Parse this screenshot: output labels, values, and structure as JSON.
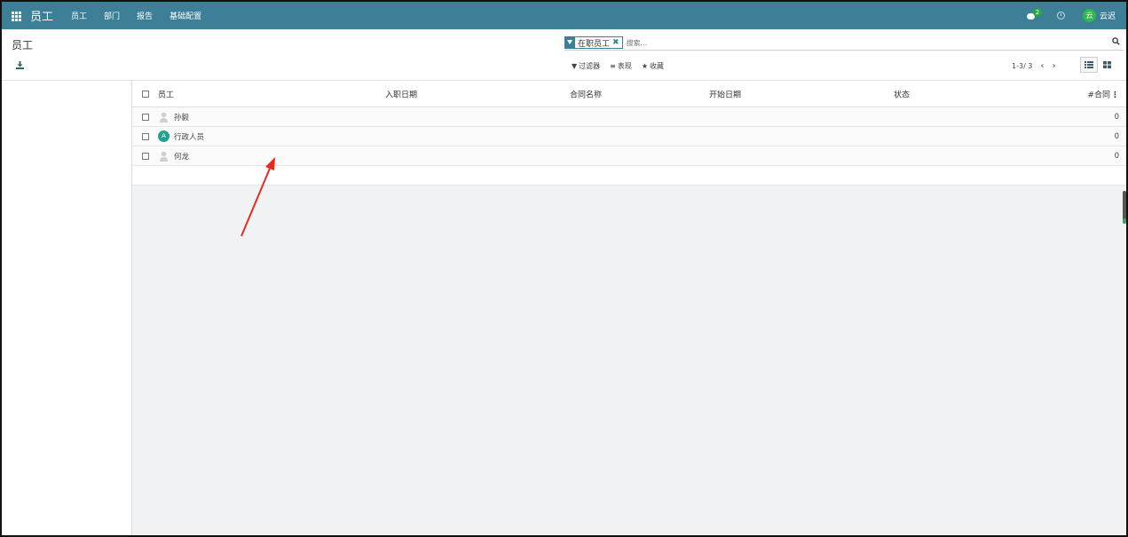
{
  "navbar": {
    "brand": "员工",
    "menu": [
      "员工",
      "部门",
      "报告",
      "基础配置"
    ],
    "chat_badge": "2",
    "user_avatar": "云",
    "user_name": "云迟"
  },
  "control_panel": {
    "title": "员工",
    "facet_label": "在职员工",
    "search_placeholder": "搜索...",
    "options": {
      "filters": "过滤器",
      "group_by": "表现",
      "favorites": "收藏"
    },
    "pager": "1-3/ 3"
  },
  "list": {
    "columns": [
      "员工",
      "入职日期",
      "合同名称",
      "开始日期",
      "状态",
      "#合同"
    ],
    "rows": [
      {
        "name": "孙毅",
        "avatar": "user-placeholder-icon",
        "count": "0"
      },
      {
        "name": "行政人员",
        "avatar": "A",
        "count": "0"
      },
      {
        "name": "何龙",
        "avatar": "user-placeholder-icon",
        "count": "0"
      }
    ]
  },
  "colors": {
    "navbar": "#3d7f97",
    "accent_green": "#28a745",
    "annotation_arrow": "#e8291c"
  }
}
